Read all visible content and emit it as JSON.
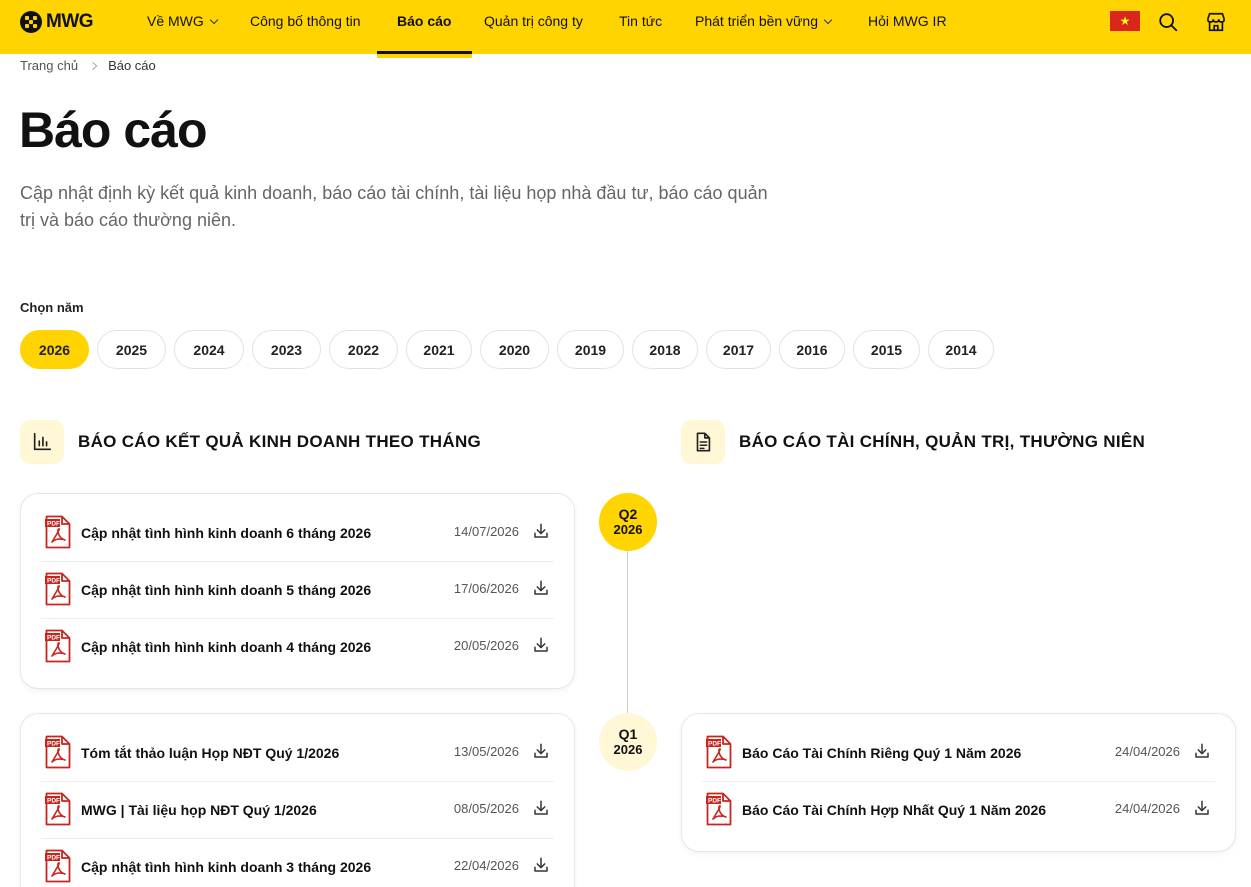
{
  "brand": {
    "logo_text": "MWG",
    "accent": "#FFD400",
    "accent_soft": "#FFF7D6"
  },
  "nav": {
    "items": [
      {
        "label": "Về MWG",
        "has_dropdown": true
      },
      {
        "label": "Công bố thông tin",
        "has_dropdown": false
      },
      {
        "label": "Báo cáo",
        "has_dropdown": false,
        "active": true
      },
      {
        "label": "Quản trị công ty",
        "has_dropdown": false
      },
      {
        "label": "Tin tức",
        "has_dropdown": false
      },
      {
        "label": "Phát triển bền vững",
        "has_dropdown": true
      },
      {
        "label": "Hỏi MWG IR",
        "has_dropdown": false
      }
    ],
    "icons": [
      "vietnam-flag-icon",
      "search-icon",
      "store-icon"
    ]
  },
  "breadcrumb": {
    "home": "Trang chủ",
    "current": "Báo cáo"
  },
  "page": {
    "title": "Báo cáo",
    "description": "Cập nhật định kỳ kết quả kinh doanh, báo cáo tài chính, tài liệu họp nhà đầu tư, báo cáo quản trị và báo cáo thường niên."
  },
  "year_filter": {
    "label": "Chọn năm",
    "selected": "2026",
    "years": [
      "2026",
      "2025",
      "2024",
      "2023",
      "2022",
      "2021",
      "2020",
      "2019",
      "2018",
      "2017",
      "2016",
      "2015",
      "2014"
    ]
  },
  "sections": {
    "monthly": {
      "title": "BÁO CÁO KẾT QUẢ KINH DOANH THEO THÁNG",
      "icon": "bar-chart-icon"
    },
    "financial": {
      "title": "BÁO CÁO TÀI CHÍNH, QUẢN TRỊ, THƯỜNG NIÊN",
      "icon": "document-icon"
    }
  },
  "timeline": [
    {
      "quarter": "Q2",
      "year": "2026"
    },
    {
      "quarter": "Q1",
      "year": "2026"
    }
  ],
  "q2_monthly": [
    {
      "title": "Cập nhật tình hình kinh doanh 6 tháng 2026",
      "date": "14/07/2026"
    },
    {
      "title": "Cập nhật tình hình kinh doanh 5 tháng 2026",
      "date": "17/06/2026"
    },
    {
      "title": "Cập nhật tình hình kinh doanh 4 tháng 2026",
      "date": "20/05/2026"
    }
  ],
  "q1_monthly": [
    {
      "title": "Tóm tắt thảo luận Họp NĐT Quý 1/2026",
      "date": "13/05/2026"
    },
    {
      "title": "MWG | Tài liệu họp NĐT Quý 1/2026",
      "date": "08/05/2026"
    },
    {
      "title": "Cập nhật tình hình kinh doanh 3 tháng 2026",
      "date": "22/04/2026"
    }
  ],
  "q1_financial": [
    {
      "title": "Báo Cáo Tài Chính Riêng Quý 1 Năm 2026",
      "date": "24/04/2026"
    },
    {
      "title": "Báo Cáo Tài Chính Hợp Nhất Quý 1 Năm 2026",
      "date": "24/04/2026"
    }
  ]
}
